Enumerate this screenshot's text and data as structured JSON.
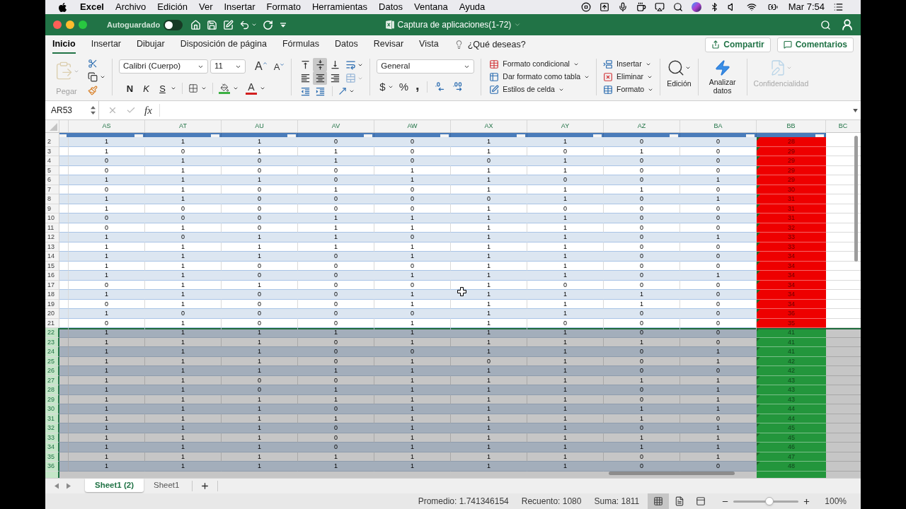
{
  "menu_bar": {
    "app": "Excel",
    "items": [
      "Archivo",
      "Edición",
      "Ver",
      "Insertar",
      "Formato",
      "Herramientas",
      "Datos",
      "Ventana",
      "Ayuda"
    ],
    "clock": "Mar 7:54"
  },
  "title_bar": {
    "autosave": {
      "label": "Autoguardado",
      "on": false
    },
    "title": "Captura de aplicaciones(1-72)"
  },
  "ribbon": {
    "tabs": [
      {
        "label": "Inicio",
        "selected": true
      },
      {
        "label": "Insertar",
        "selected": false
      },
      {
        "label": "Dibujar",
        "selected": false
      },
      {
        "label": "Disposición de página",
        "selected": false
      },
      {
        "label": "Fórmulas",
        "selected": false
      },
      {
        "label": "Datos",
        "selected": false
      },
      {
        "label": "Revisar",
        "selected": false
      },
      {
        "label": "Vista",
        "selected": false
      }
    ],
    "tell_me": "¿Qué deseas?",
    "share": "Compartir",
    "comments": "Comentarios",
    "clipboard": {
      "paste": {
        "label": "Pegar",
        "disabled": true
      }
    },
    "font": {
      "name": "Calibri (Cuerpo)",
      "size": "11",
      "grow": "A",
      "shrink": "A",
      "styles": [
        "N",
        "K",
        "S"
      ],
      "font_color": "A"
    },
    "alignment": {
      "vertical": [
        {
          "kind": "top",
          "selected": false
        },
        {
          "kind": "middle",
          "selected": true
        },
        {
          "kind": "bottom",
          "selected": false
        }
      ],
      "horizontal": [
        {
          "kind": "left",
          "selected": false
        },
        {
          "kind": "center",
          "selected": true
        },
        {
          "kind": "right",
          "selected": false
        }
      ]
    },
    "number": {
      "format": "General",
      "symbols": [
        "$",
        "%",
        ","
      ]
    },
    "styles": [
      {
        "kind": "conditional",
        "label": "Formato condicional"
      },
      {
        "kind": "table",
        "label": "Dar formato como tabla"
      },
      {
        "kind": "cell_styles",
        "label": "Estilos de celda"
      }
    ],
    "cells": [
      {
        "kind": "insert",
        "label": "Insertar"
      },
      {
        "kind": "delete",
        "label": "Eliminar"
      },
      {
        "kind": "format",
        "label": "Formato"
      }
    ],
    "editing": "Edición",
    "analyze": "Analizar datos",
    "sensitivity": {
      "label": "Confidencialidad",
      "disabled": true
    }
  },
  "formula_bar": {
    "name_box": "AR53",
    "function_label": "fx"
  },
  "sheet": {
    "columns": [
      "AS",
      "AT",
      "AU",
      "AV",
      "AW",
      "AX",
      "AY",
      "AZ",
      "BA",
      "BB",
      "BC"
    ],
    "rows": [
      {
        "number": "2",
        "selected": false,
        "values": [
          "1",
          "1",
          "1",
          "0",
          "0",
          "1",
          "1",
          "0",
          "0"
        ],
        "score": "28",
        "color": "#ee0000"
      },
      {
        "number": "3",
        "selected": false,
        "values": [
          "1",
          "0",
          "1",
          "1",
          "0",
          "1",
          "0",
          "1",
          "0"
        ],
        "score": "29",
        "color": "#ee0000"
      },
      {
        "number": "4",
        "selected": false,
        "values": [
          "0",
          "1",
          "0",
          "1",
          "0",
          "0",
          "1",
          "0",
          "0"
        ],
        "score": "29",
        "color": "#ee0000"
      },
      {
        "number": "5",
        "selected": false,
        "values": [
          "0",
          "1",
          "0",
          "0",
          "1",
          "1",
          "1",
          "0",
          "0"
        ],
        "score": "29",
        "color": "#ee0000"
      },
      {
        "number": "6",
        "selected": false,
        "values": [
          "1",
          "1",
          "1",
          "0",
          "1",
          "1",
          "0",
          "0",
          "1"
        ],
        "score": "29",
        "color": "#ee0000"
      },
      {
        "number": "7",
        "selected": false,
        "values": [
          "0",
          "1",
          "0",
          "1",
          "0",
          "1",
          "1",
          "1",
          "0"
        ],
        "score": "30",
        "color": "#ee0000"
      },
      {
        "number": "8",
        "selected": false,
        "values": [
          "1",
          "1",
          "0",
          "0",
          "0",
          "0",
          "1",
          "0",
          "1"
        ],
        "score": "31",
        "color": "#ee0000"
      },
      {
        "number": "9",
        "selected": false,
        "values": [
          "1",
          "0",
          "0",
          "0",
          "0",
          "1",
          "0",
          "0",
          "0"
        ],
        "score": "31",
        "color": "#ee0000"
      },
      {
        "number": "10",
        "selected": false,
        "values": [
          "0",
          "0",
          "0",
          "1",
          "1",
          "1",
          "1",
          "0",
          "0"
        ],
        "score": "31",
        "color": "#ee0000"
      },
      {
        "number": "11",
        "selected": false,
        "values": [
          "0",
          "1",
          "0",
          "1",
          "1",
          "1",
          "1",
          "0",
          "0"
        ],
        "score": "32",
        "color": "#ee0000"
      },
      {
        "number": "12",
        "selected": false,
        "values": [
          "1",
          "0",
          "1",
          "1",
          "0",
          "1",
          "1",
          "0",
          "1"
        ],
        "score": "33",
        "color": "#ee0000"
      },
      {
        "number": "13",
        "selected": false,
        "values": [
          "1",
          "1",
          "1",
          "1",
          "1",
          "1",
          "1",
          "0",
          "0"
        ],
        "score": "33",
        "color": "#ee0000"
      },
      {
        "number": "14",
        "selected": false,
        "values": [
          "1",
          "1",
          "1",
          "0",
          "1",
          "1",
          "1",
          "0",
          "0"
        ],
        "score": "34",
        "color": "#ee0000"
      },
      {
        "number": "15",
        "selected": false,
        "values": [
          "1",
          "1",
          "0",
          "0",
          "0",
          "1",
          "1",
          "0",
          "0"
        ],
        "score": "34",
        "color": "#ee0000"
      },
      {
        "number": "16",
        "selected": false,
        "values": [
          "1",
          "1",
          "0",
          "0",
          "1",
          "1",
          "1",
          "0",
          "1"
        ],
        "score": "34",
        "color": "#ee0000"
      },
      {
        "number": "17",
        "selected": false,
        "values": [
          "0",
          "1",
          "1",
          "0",
          "0",
          "1",
          "0",
          "0",
          "0"
        ],
        "score": "34",
        "color": "#ee0000"
      },
      {
        "number": "18",
        "selected": false,
        "values": [
          "1",
          "1",
          "0",
          "0",
          "1",
          "1",
          "1",
          "1",
          "0"
        ],
        "score": "34",
        "color": "#ee0000"
      },
      {
        "number": "19",
        "selected": false,
        "values": [
          "0",
          "1",
          "0",
          "0",
          "1",
          "1",
          "1",
          "1",
          "0"
        ],
        "score": "34",
        "color": "#ee0000"
      },
      {
        "number": "20",
        "selected": false,
        "values": [
          "1",
          "0",
          "0",
          "0",
          "0",
          "1",
          "1",
          "0",
          "0"
        ],
        "score": "36",
        "color": "#ee0000"
      },
      {
        "number": "21",
        "selected": false,
        "values": [
          "0",
          "1",
          "0",
          "0",
          "1",
          "1",
          "0",
          "0",
          "0"
        ],
        "score": "35",
        "color": "#ee0000"
      },
      {
        "number": "22",
        "selected": true,
        "values": [
          "1",
          "1",
          "1",
          "1",
          "1",
          "1",
          "1",
          "0",
          "0"
        ],
        "score": "41",
        "color": "#23963c"
      },
      {
        "number": "23",
        "selected": true,
        "values": [
          "1",
          "1",
          "1",
          "0",
          "1",
          "1",
          "1",
          "1",
          "0"
        ],
        "score": "41",
        "color": "#23963c"
      },
      {
        "number": "24",
        "selected": true,
        "values": [
          "1",
          "1",
          "1",
          "0",
          "0",
          "1",
          "1",
          "0",
          "1"
        ],
        "score": "41",
        "color": "#23963c"
      },
      {
        "number": "25",
        "selected": true,
        "values": [
          "1",
          "1",
          "1",
          "0",
          "1",
          "0",
          "1",
          "0",
          "1"
        ],
        "score": "42",
        "color": "#23963c"
      },
      {
        "number": "26",
        "selected": true,
        "values": [
          "1",
          "1",
          "1",
          "1",
          "1",
          "1",
          "1",
          "0",
          "0"
        ],
        "score": "42",
        "color": "#23963c"
      },
      {
        "number": "27",
        "selected": true,
        "values": [
          "1",
          "1",
          "0",
          "0",
          "1",
          "1",
          "1",
          "1",
          "1"
        ],
        "score": "43",
        "color": "#23963c"
      },
      {
        "number": "28",
        "selected": true,
        "values": [
          "1",
          "1",
          "0",
          "1",
          "1",
          "1",
          "1",
          "0",
          "1"
        ],
        "score": "43",
        "color": "#23963c"
      },
      {
        "number": "29",
        "selected": true,
        "values": [
          "1",
          "1",
          "1",
          "1",
          "1",
          "1",
          "1",
          "0",
          "1"
        ],
        "score": "43",
        "color": "#23963c"
      },
      {
        "number": "30",
        "selected": true,
        "values": [
          "1",
          "1",
          "1",
          "0",
          "1",
          "1",
          "1",
          "1",
          "1"
        ],
        "score": "44",
        "color": "#23963c"
      },
      {
        "number": "31",
        "selected": true,
        "values": [
          "1",
          "1",
          "1",
          "1",
          "1",
          "1",
          "1",
          "1",
          "0"
        ],
        "score": "44",
        "color": "#23963c"
      },
      {
        "number": "32",
        "selected": true,
        "values": [
          "1",
          "1",
          "1",
          "0",
          "1",
          "1",
          "1",
          "0",
          "1"
        ],
        "score": "45",
        "color": "#23963c"
      },
      {
        "number": "33",
        "selected": true,
        "values": [
          "1",
          "1",
          "1",
          "0",
          "1",
          "1",
          "1",
          "1",
          "1"
        ],
        "score": "45",
        "color": "#23963c"
      },
      {
        "number": "34",
        "selected": true,
        "values": [
          "1",
          "1",
          "1",
          "0",
          "1",
          "1",
          "1",
          "1",
          "1"
        ],
        "score": "46",
        "color": "#23963c"
      },
      {
        "number": "35",
        "selected": true,
        "values": [
          "1",
          "1",
          "1",
          "1",
          "1",
          "1",
          "1",
          "0",
          "1"
        ],
        "score": "47",
        "color": "#23963c"
      },
      {
        "number": "36",
        "selected": true,
        "values": [
          "1",
          "1",
          "1",
          "1",
          "1",
          "1",
          "1",
          "0",
          "0"
        ],
        "score": "48",
        "color": "#23963c"
      }
    ]
  },
  "sheet_tabs": [
    {
      "label": "Sheet1 (2)",
      "selected": true
    },
    {
      "label": "Sheet1",
      "selected": false
    }
  ],
  "status_bar": {
    "average": "Promedio: 1.741346154",
    "count": "Recuento: 1080",
    "sum": "Suma: 1811",
    "views": [
      {
        "kind": "normal",
        "selected": true
      },
      {
        "kind": "page_layout",
        "selected": false
      },
      {
        "kind": "page_break",
        "selected": false
      }
    ],
    "zoom": {
      "level": 0.55,
      "label": "100%"
    }
  }
}
